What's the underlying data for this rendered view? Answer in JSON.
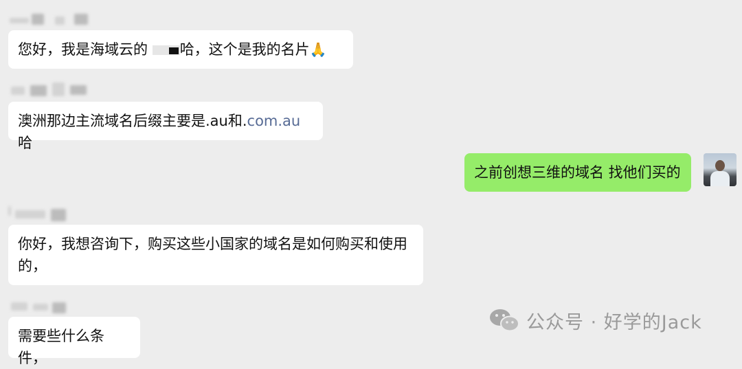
{
  "messages": [
    {
      "id": "m1",
      "side": "left",
      "parts": [
        "您好，我是海域云的 ",
        "[redacted]",
        "哈，这个是我的名片",
        "🙏"
      ]
    },
    {
      "id": "m2",
      "side": "left",
      "parts": [
        "澳洲那边主流域名后缀主要是.au和.",
        "com.au",
        "哈"
      ]
    },
    {
      "id": "m3",
      "side": "right",
      "text": "之前创想三维的域名 找他们买的"
    },
    {
      "id": "m4",
      "side": "left",
      "line1": "你好，我想咨询下，购买这些小国家的域名是如何购买和使用",
      "line2": "的，"
    },
    {
      "id": "m5",
      "side": "left",
      "text": "需要些什么条件，"
    }
  ],
  "watermark": {
    "text": "公众号 · 好学的Jack",
    "icon": "wechat-icon"
  },
  "colors": {
    "background": "#ededed",
    "incoming_bubble": "#ffffff",
    "outgoing_bubble": "#95ec69",
    "link": "#576b95"
  }
}
